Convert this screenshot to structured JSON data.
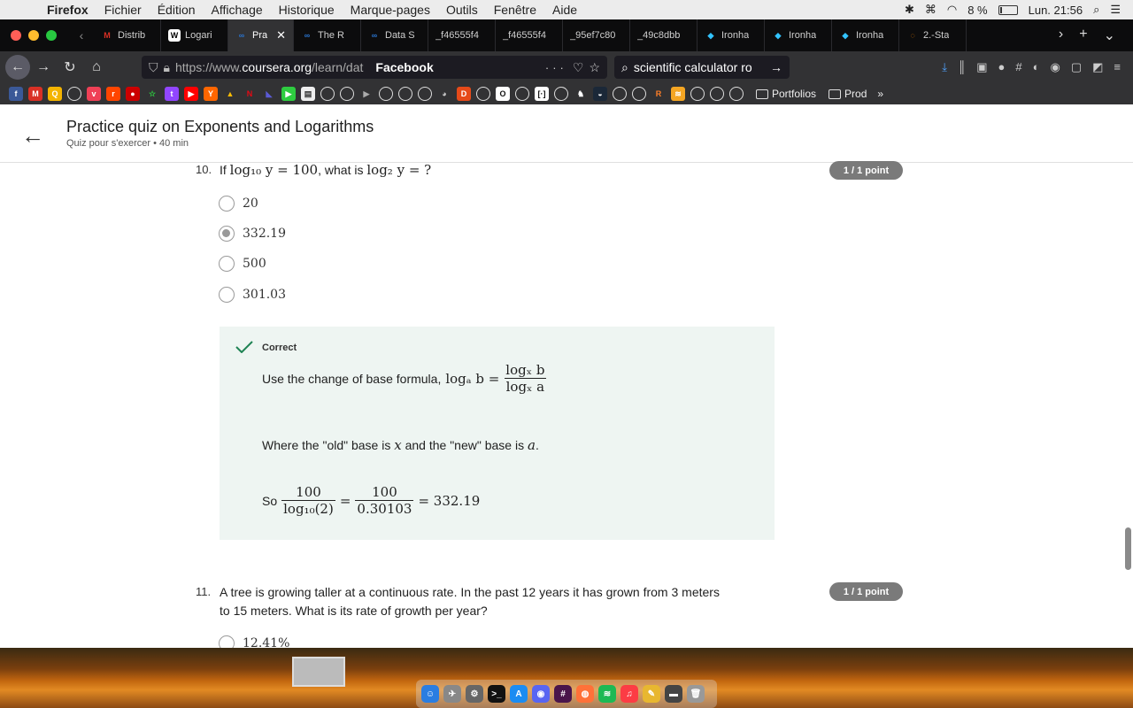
{
  "menubar": {
    "app": "Firefox",
    "items": [
      "Fichier",
      "Édition",
      "Affichage",
      "Historique",
      "Marque-pages",
      "Outils",
      "Fenêtre",
      "Aide"
    ],
    "battery": "8 %",
    "clock": "Lun. 21:56"
  },
  "tabs": [
    {
      "label": "Distrib",
      "icon": "gmail-icon",
      "color": "#d93025"
    },
    {
      "label": "Logari",
      "icon": "wikipedia-icon",
      "color": "#ffffff"
    },
    {
      "label": "Pra",
      "icon": "coursera-icon",
      "color": "#2a73cc"
    },
    {
      "label": "The R",
      "icon": "coursera-icon",
      "color": "#2a73cc"
    },
    {
      "label": "Data S",
      "icon": "coursera-icon",
      "color": "#2a73cc"
    },
    {
      "label": "_f46555f4",
      "icon": "blank-icon",
      "color": "#555555"
    },
    {
      "label": "_f46555f4",
      "icon": "blank-icon",
      "color": "#555555"
    },
    {
      "label": "_95ef7c80",
      "icon": "blank-icon",
      "color": "#555555"
    },
    {
      "label": "_49c8dbb",
      "icon": "blank-icon",
      "color": "#555555"
    },
    {
      "label": "Ironha",
      "icon": "ironhack-icon",
      "color": "#32c3ff"
    },
    {
      "label": "Ironha",
      "icon": "ironhack-icon",
      "color": "#32c3ff"
    },
    {
      "label": "Ironha",
      "icon": "ironhack-icon",
      "color": "#32c3ff"
    },
    {
      "label": "2.-Sta",
      "icon": "loading-icon",
      "color": "#ff8a00"
    }
  ],
  "nav": {
    "url_prefix": "https://www.",
    "url_host": "coursera.org",
    "url_path": "/learn/dat",
    "page_label": "Facebook",
    "search": "scientific calculator ro"
  },
  "bookmarks": {
    "folders": [
      "Portfolios",
      "Prod"
    ]
  },
  "quiz": {
    "title": "Practice quiz on Exponents and Logarithms",
    "subtitle": "Quiz pour s'exercer • 40  min"
  },
  "q10": {
    "number": "10.",
    "prefix": "If",
    "formula1": "log₁₀ y = 100",
    "middle": ", what is",
    "formula2": "log₂ y = ?",
    "points": "1 / 1 point",
    "options": [
      {
        "label": "20",
        "selected": false
      },
      {
        "label": "332.19",
        "selected": true
      },
      {
        "label": "500",
        "selected": false
      },
      {
        "label": "301.03",
        "selected": false
      }
    ],
    "feedback": {
      "status": "Correct",
      "line1": "Use the change of base formula,",
      "line1_math": "logₐ b =",
      "frac1_num": "logₓ b",
      "frac1_den": "logₓ a",
      "line2_a": "Where the \"old\" base is",
      "line2_x": "x",
      "line2_b": "and the \"new\" base is",
      "line2_a_var": "a",
      "line2_end": ".",
      "line3_so": "So",
      "frac2_num": "100",
      "frac2_den": "log₁₀(2)",
      "eq": "=",
      "frac3_num": "100",
      "frac3_den": "0.30103",
      "result": "= 332.19"
    }
  },
  "q11": {
    "number": "11.",
    "text1": "A tree is growing taller at a continuous rate. In the past 12 years it has grown from 3 meters",
    "text2": "to 15 meters. What is its rate of growth per year?",
    "points": "1 / 1 point",
    "first_option": "12.41%"
  }
}
